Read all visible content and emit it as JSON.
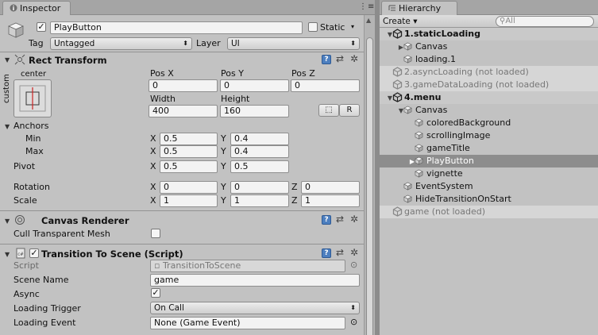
{
  "inspector": {
    "tab_label": "Inspector",
    "window_buttons": "⋮≡",
    "gameobject": {
      "active": true,
      "name": "PlayButton",
      "static_label": "Static",
      "static_checked": false,
      "tag_label": "Tag",
      "tag_value": "Untagged",
      "layer_label": "Layer",
      "layer_value": "UI"
    },
    "rect_transform": {
      "title": "Rect Transform",
      "anchor_preset_h": "center",
      "anchor_preset_v": "custom",
      "col_labels": [
        "Pos X",
        "Pos Y",
        "Pos Z"
      ],
      "pos": [
        "0",
        "0",
        "0"
      ],
      "width_label": "Width",
      "height_label": "Height",
      "width": "400",
      "height": "160",
      "r_button": "R",
      "anchors_label": "Anchors",
      "min_label": "Min",
      "max_label": "Max",
      "min": [
        "0.5",
        "0.4"
      ],
      "max": [
        "0.5",
        "0.4"
      ],
      "pivot_label": "Pivot",
      "pivot": [
        "0.5",
        "0.5"
      ],
      "rotation_label": "Rotation",
      "rotation": [
        "0",
        "0",
        "0"
      ],
      "scale_label": "Scale",
      "scale": [
        "1",
        "1",
        "1"
      ],
      "axis_x": "X",
      "axis_y": "Y",
      "axis_z": "Z"
    },
    "canvas_renderer": {
      "title": "Canvas Renderer",
      "cull_label": "Cull Transparent Mesh",
      "cull_checked": false
    },
    "transition_script": {
      "title": "Transition To Scene (Script)",
      "enabled": true,
      "script_label": "Script",
      "script_value": "TransitionToScene",
      "scene_name_label": "Scene Name",
      "scene_name_value": "game",
      "async_label": "Async",
      "async_checked": true,
      "trigger_label": "Loading Trigger",
      "trigger_value": "On Call",
      "event_label": "Loading Event",
      "event_value": "None (Game Event)"
    }
  },
  "hierarchy": {
    "tab_label": "Hierarchy",
    "create_label": "Create ▾",
    "search_placeholder": "All",
    "rows": [
      {
        "label": "1.staticLoading",
        "kind": "scene"
      },
      {
        "label": "Canvas",
        "kind": "object"
      },
      {
        "label": "loading.1",
        "kind": "object"
      },
      {
        "label": "2.asyncLoading (not loaded)",
        "kind": "unloaded"
      },
      {
        "label": "3.gameDataLoading (not loaded)",
        "kind": "unloaded"
      },
      {
        "label": "4.menu",
        "kind": "scene"
      },
      {
        "label": "Canvas",
        "kind": "object"
      },
      {
        "label": "coloredBackground",
        "kind": "object"
      },
      {
        "label": "scrollingImage",
        "kind": "object"
      },
      {
        "label": "gameTitle",
        "kind": "object"
      },
      {
        "label": "PlayButton",
        "kind": "object",
        "selected": true
      },
      {
        "label": "vignette",
        "kind": "object"
      },
      {
        "label": "EventSystem",
        "kind": "object"
      },
      {
        "label": "HideTransitionOnStart",
        "kind": "object"
      },
      {
        "label": "game (not loaded)",
        "kind": "unloaded"
      }
    ]
  },
  "colors": {
    "panel_bg": "#c2c2c2",
    "selection": "#8d8d8d",
    "help_icon": "#4d7fbf"
  }
}
